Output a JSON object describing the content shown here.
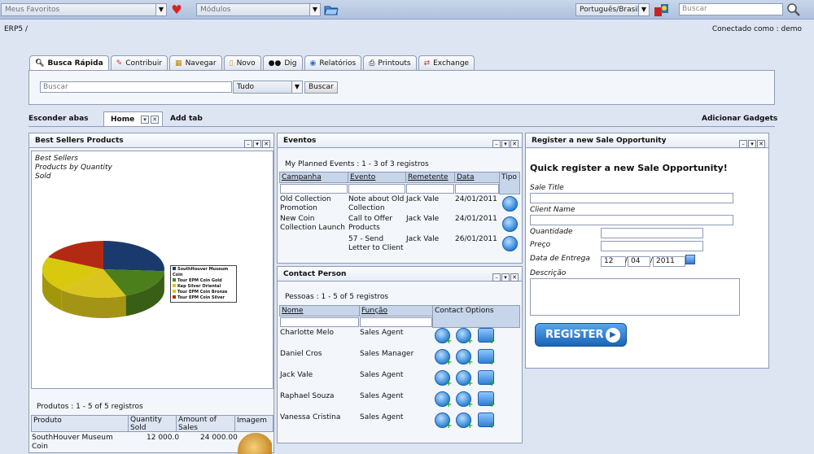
{
  "topbar": {
    "favorites": "Meus Favoritos",
    "modules": "Módulos",
    "language": "Português/Brasil",
    "search_placeholder": "Buscar"
  },
  "breadcrumb": "ERP5 /",
  "connected_as": "Conectado como : demo",
  "tabs": [
    {
      "label": "Busca Rápida",
      "icon": "magnifier-icon"
    },
    {
      "label": "Contribuir",
      "icon": "pencil-icon"
    },
    {
      "label": "Navegar",
      "icon": "table-icon"
    },
    {
      "label": "Novo",
      "icon": "document-icon"
    },
    {
      "label": "Dig",
      "icon": "binoculars-icon"
    },
    {
      "label": "Relatórios",
      "icon": "globe-icon"
    },
    {
      "label": "Printouts",
      "icon": "printer-icon"
    },
    {
      "label": "Exchange",
      "icon": "exchange-icon"
    }
  ],
  "quick_search": {
    "placeholder": "Buscar",
    "scope": "Tudo",
    "button": "Buscar"
  },
  "dashboard": {
    "hide_tabs": "Esconder abas",
    "home_tab": "Home",
    "add_tab": "Add tab",
    "add_gadgets": "Adicionar Gadgets"
  },
  "best_sellers": {
    "title": "Best Sellers Products",
    "chart_title_lines": [
      "Best Sellers",
      "Products by Quantity",
      "Sold"
    ],
    "legend": [
      "SouthHouver Museum Coin",
      "Tour EPM Coin Gold",
      "Kep Silver Oriental",
      "Tour EPM Coin Bronze",
      "Tour EPM Coin Silver"
    ],
    "summary": "Produtos :  1 - 5 of 5 registros",
    "columns": [
      "Produto",
      "Quantity Sold",
      "Amount of Sales",
      "Imagem"
    ],
    "rows": [
      {
        "product": "SouthHouver Museum Coin",
        "quantity": "12 000.0",
        "amount": "24 000.00"
      }
    ]
  },
  "chart_data": {
    "type": "pie",
    "title": "Best Sellers Products by Quantity Sold",
    "categories": [
      "SouthHouver Museum Coin",
      "Tour EPM Coin Gold",
      "Kep Silver Oriental",
      "Tour EPM Coin Bronze",
      "Tour EPM Coin Silver"
    ],
    "values": [
      26,
      18,
      18,
      20,
      18
    ],
    "colors": [
      "#1a3a6e",
      "#4b7f1c",
      "#d9c51d",
      "#d8c80e",
      "#b22a14"
    ],
    "legend": "right"
  },
  "events": {
    "title": "Eventos",
    "summary": "My Planned Events :  1 - 3 of 3 registros",
    "columns": [
      "Campanha",
      "Evento",
      "Remetente",
      "Data",
      "Tipo"
    ],
    "rows": [
      {
        "campaign": "Old Collection Promotion",
        "event": "Note about Old Collection",
        "sender": "Jack Vale",
        "date": "24/01/2011"
      },
      {
        "campaign": "New Coin Collection Launch",
        "event": "Call to Offer Products",
        "sender": "Jack Vale",
        "date": "24/01/2011"
      },
      {
        "campaign": "",
        "event": "57 - Send Letter to Client",
        "sender": "Jack Vale",
        "date": "26/01/2011"
      }
    ]
  },
  "contacts": {
    "title": "Contact Person",
    "summary": "Pessoas :  1 - 5 of 5 registros",
    "columns": [
      "Nome",
      "Função",
      "Contact Options"
    ],
    "rows": [
      {
        "name": "Charlotte Melo",
        "role": "Sales Agent"
      },
      {
        "name": "Daniel Cros",
        "role": "Sales Manager"
      },
      {
        "name": "Jack Vale",
        "role": "Sales Agent"
      },
      {
        "name": "Raphael Souza",
        "role": "Sales Agent"
      },
      {
        "name": "Vanessa Cristina",
        "role": "Sales Agent"
      }
    ]
  },
  "register": {
    "title": "Register a new Sale Opportunity",
    "heading": "Quick register a new Sale Opportunity!",
    "sale_title": "Sale Title",
    "client_name": "Client Name",
    "quantity": "Quantidade",
    "price": "Preço",
    "delivery_date": "Data de Entrega",
    "day": "12",
    "month": "04",
    "year": "2011",
    "description": "Descrição",
    "button": "REGISTER"
  }
}
